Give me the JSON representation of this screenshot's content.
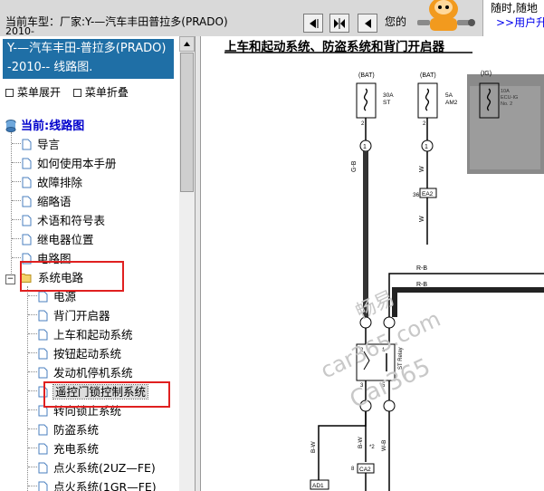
{
  "topbar": {
    "car_label": "当前车型：厂家:Y-—汽车丰田普拉多(PRADO)",
    "car_label_cont": "2010-",
    "your_text": "您的",
    "nav_buttons": [
      "prev-chapter",
      "expand-view",
      "next-chapter"
    ],
    "ad_line1": "随时,随地",
    "ad_line2": ">>用户升"
  },
  "sidebar": {
    "title_line1": "Y-—汽车丰田-普拉多(PRADO)",
    "title_line2": "-2010-- 线路图.",
    "expand_label": "菜单展开",
    "collapse_label": "菜单折叠",
    "root_label": "当前:线路图",
    "items": [
      "导言",
      "如何使用本手册",
      "故障排除",
      "缩略语",
      "术语和符号表",
      "继电器位置",
      "电路图",
      "系统电路"
    ],
    "subitems": [
      "电源",
      "背门开启器",
      "上车和起动系统",
      "按钮起动系统",
      "发动机停机系统",
      "遥控门锁控制系统",
      "转向锁止系统",
      "防盗系统",
      "充电系统",
      "点火系统(2UZ—FE)",
      "点火系统(1GR—FE)"
    ]
  },
  "diagram": {
    "title": "上车和起动系统、防盗系统和背门开启器",
    "bat1": "(BAT)",
    "bat2": "(BAT)",
    "ig": "(IG)",
    "fuse1_amp": "30A",
    "fuse1_name": "ST",
    "fuse2_amp": "5A",
    "fuse2_name": "AM2",
    "fuse3_name": "ECU-IG",
    "fuse3_no": "No. 2",
    "fuse3_amp": "10A",
    "pin2a": "2",
    "pin2b": "2",
    "pin1a": "1",
    "pin1b": "1",
    "pin36": "36",
    "ea2": "EA2",
    "wire_gb": "G-B",
    "wire_w1": "W",
    "wire_w2": "W",
    "wire_rb1": "R-B",
    "wire_rb2": "R-B",
    "relay_name": "ST Relay",
    "relay_pin2": "2",
    "relay_pin3": "3",
    "relay_pin1": "1",
    "relay_pin5": "5",
    "wire_bw1": "B-W",
    "wire_bw2": "B-W",
    "wire_bw2n": "*2",
    "wire_wb": "W-B",
    "pin8": "8",
    "ca2": "CA2",
    "ad1": "AD1",
    "watermark1": "畅易",
    "watermark2": "car365.com",
    "watermark3": "Car365"
  }
}
